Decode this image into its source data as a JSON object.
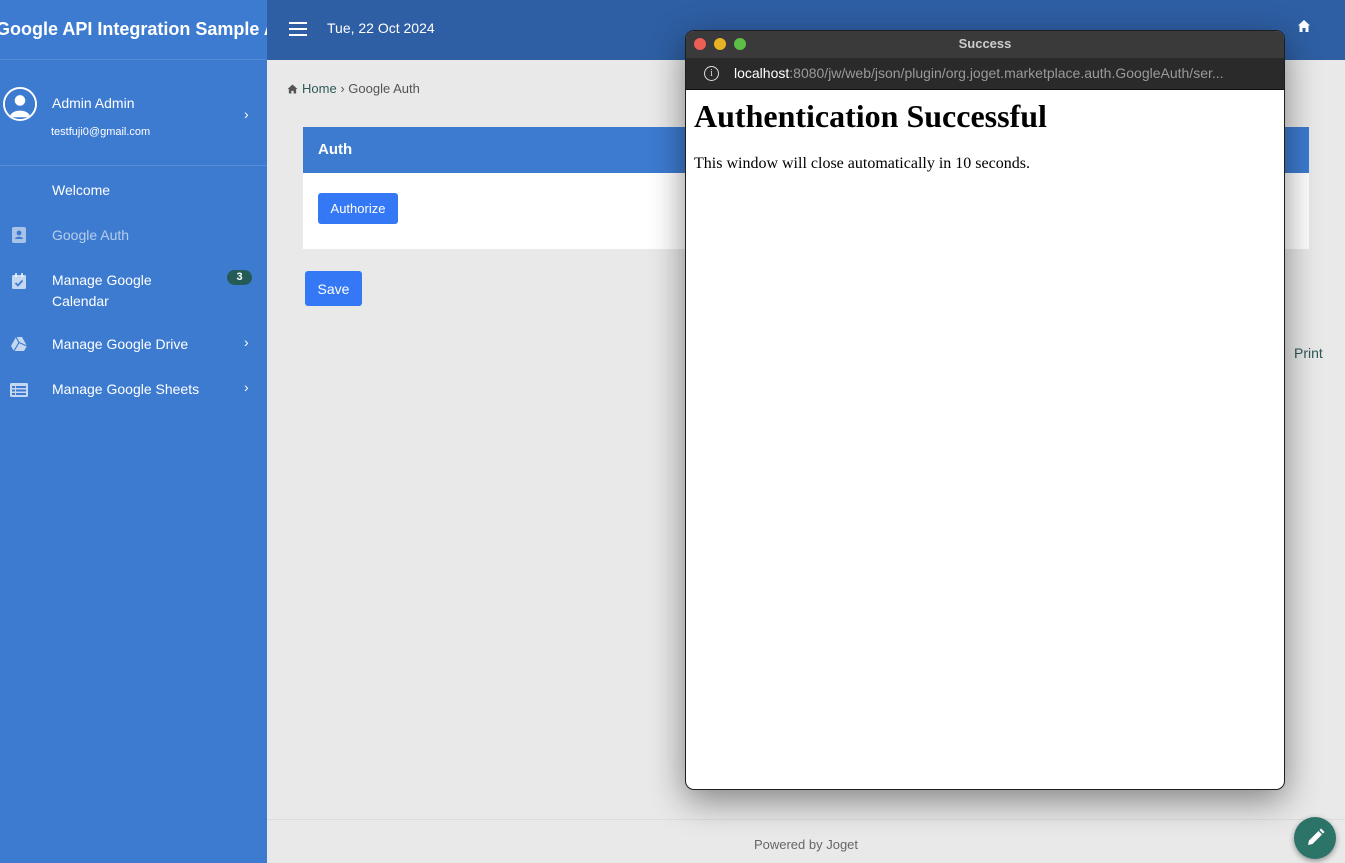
{
  "app": {
    "title": "Google API Integration Sample App"
  },
  "header": {
    "date": "Tue, 22 Oct 2024"
  },
  "profile": {
    "name": "Admin Admin",
    "email": "testfuji0@gmail.com"
  },
  "sidebar": {
    "items": [
      {
        "label": "Welcome",
        "icon": "none"
      },
      {
        "label": "Google Auth",
        "icon": "contact-card-icon"
      },
      {
        "label": "Manage Google Calendar",
        "icon": "calendar-check-icon",
        "badge": "3"
      },
      {
        "label": "Manage Google Drive",
        "icon": "google-drive-icon"
      },
      {
        "label": "Manage Google Sheets",
        "icon": "sheets-list-icon"
      }
    ]
  },
  "breadcrumb": {
    "home": "Home",
    "current": "Google Auth"
  },
  "panel": {
    "title": "Auth",
    "authorize_label": "Authorize"
  },
  "actions": {
    "save_label": "Save",
    "print_label": "Print"
  },
  "footer": {
    "text": "Powered by Joget"
  },
  "popup": {
    "window_title": "Success",
    "url_host": "localhost",
    "url_rest": ":8080/jw/web/json/plugin/org.joget.marketplace.auth.GoogleAuth/ser...",
    "heading": "Authentication Successful",
    "message": "This window will close automatically in 10 seconds."
  },
  "colors": {
    "sidebar": "#3d7bd0",
    "topbar": "#2e5fa4",
    "button": "#3478f6",
    "badge": "#245b57",
    "fab": "#2c7468"
  }
}
